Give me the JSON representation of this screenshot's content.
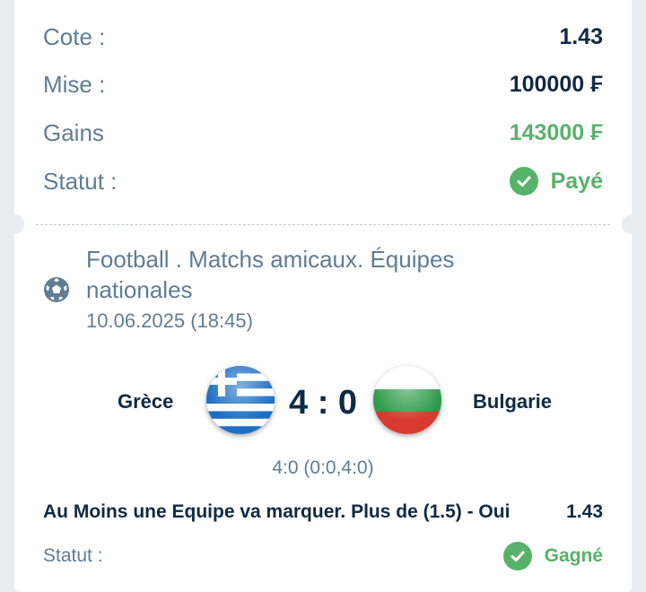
{
  "summary": {
    "cote_label": "Cote :",
    "cote_value": "1.43",
    "mise_label": "Mise :",
    "mise_value": "100000 ₣",
    "gains_label": "Gains",
    "gains_value": "143000 ₣",
    "statut_label": "Statut :",
    "statut_value": "Payé"
  },
  "event": {
    "league": "Football . Matchs amicaux. Équipes nationales",
    "date": "10.06.2025 (18:45)",
    "home_team": "Grèce",
    "away_team": "Bulgarie",
    "score": "4 : 0",
    "score_detail": "4:0 (0:0,4:0)",
    "market": "Au Moins une Equipe va marquer. Plus de (1.5) - Oui",
    "odds": "1.43",
    "statut_label": "Statut :",
    "statut_value": "Gagné"
  },
  "colors": {
    "label": "#5f7d95",
    "value": "#0f2a44",
    "success": "#57b36a"
  }
}
